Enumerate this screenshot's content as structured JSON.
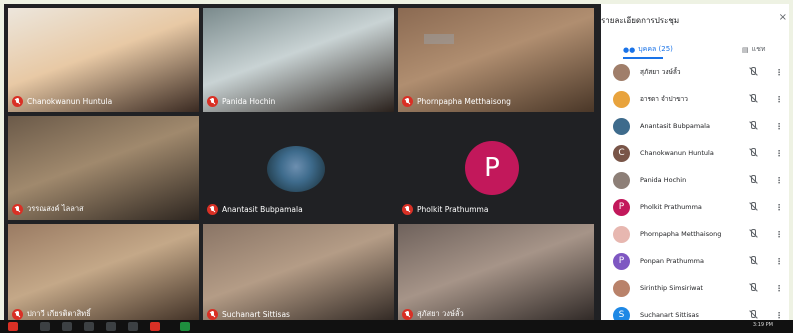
{
  "tiles": [
    {
      "name": "Chanokwanun Huntula",
      "kind": "video",
      "colors": [
        "#ece6dc",
        "#e8c9a5",
        "#3a2a22"
      ]
    },
    {
      "name": "Panida Hochin",
      "kind": "video",
      "colors": [
        "#7a8a8c",
        "#c9d3d4",
        "#2a211c"
      ]
    },
    {
      "name": "Phornpapha Metthaisong",
      "kind": "video",
      "colors": [
        "#8b6a52",
        "#b08e70",
        "#4a3728"
      ]
    },
    {
      "name": "วรรณสงค์ ไลลาส",
      "kind": "video",
      "colors": [
        "#6b5a49",
        "#a0896d",
        "#2e2620"
      ]
    },
    {
      "name": "Anantasit Bubpamala",
      "kind": "avatar-image",
      "colors": [
        "#202124"
      ]
    },
    {
      "name": "Pholkit Prathumma",
      "kind": "avatar-letter",
      "letter": "P",
      "colors": [
        "#c2185b"
      ]
    },
    {
      "name": "ปกาวี เกียรติตาสิทธิ์",
      "kind": "video",
      "colors": [
        "#9a7b63",
        "#c4a888",
        "#3b2c22"
      ]
    },
    {
      "name": "Suchanart Sittisas",
      "kind": "video",
      "colors": [
        "#8a7566",
        "#b49c86",
        "#2c2420"
      ]
    },
    {
      "name": "สุภัสยา วงษ์ลั้ว",
      "kind": "video",
      "colors": [
        "#6f625c",
        "#a69488",
        "#2a2422"
      ]
    }
  ],
  "panel": {
    "title": "รายละเอียดการประชุม",
    "close": "×",
    "people_tab": "บุคคล (25)",
    "chat_tab": "แชท",
    "participants": [
      {
        "name": "สุภัสยา วงษ์ลั้ว",
        "avatar": "photo",
        "color": "#a07e6a"
      },
      {
        "name": "อารดา จำปาขาว",
        "avatar": "photo",
        "color": "#e8a33d"
      },
      {
        "name": "Anantasit Bubpamala",
        "avatar": "photo",
        "color": "#3e6b8c"
      },
      {
        "name": "Chanokwanun Huntula",
        "avatar": "C",
        "color": "#795548"
      },
      {
        "name": "Panida Hochin",
        "avatar": "photo",
        "color": "#8d7f77"
      },
      {
        "name": "Pholkit Prathumma",
        "avatar": "P",
        "color": "#c2185b"
      },
      {
        "name": "Phornpapha Metthaisong",
        "avatar": "photo",
        "color": "#e7b7b0"
      },
      {
        "name": "Ponpan Prathumma",
        "avatar": "P",
        "color": "#7e57c2"
      },
      {
        "name": "Sirinthip Simsiriwat",
        "avatar": "photo",
        "color": "#b9826a"
      },
      {
        "name": "Suchanart Sittisas",
        "avatar": "S",
        "color": "#1e88e5"
      }
    ]
  },
  "taskbar": {
    "clock": "3:19 PM"
  }
}
